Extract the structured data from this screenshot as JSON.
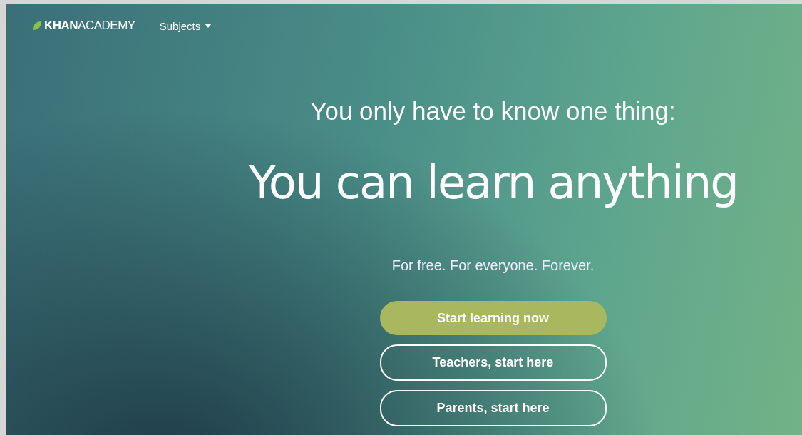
{
  "header": {
    "logo": "**KHAN**ACADEMY",
    "nav": [
      {
        "label": "Subjects",
        "has_menu": true
      }
    ]
  },
  "hero": {
    "intro": "You only have to know one thing:",
    "headline": "You can learn anything",
    "tagline": "For free. For everyone. Forever.",
    "buttons": [
      {
        "label": "Start learning now",
        "kind": "primary"
      },
      {
        "label": "Teachers, start here",
        "kind": "outline"
      },
      {
        "label": "Parents, start here",
        "kind": "outline"
      }
    ]
  }
}
